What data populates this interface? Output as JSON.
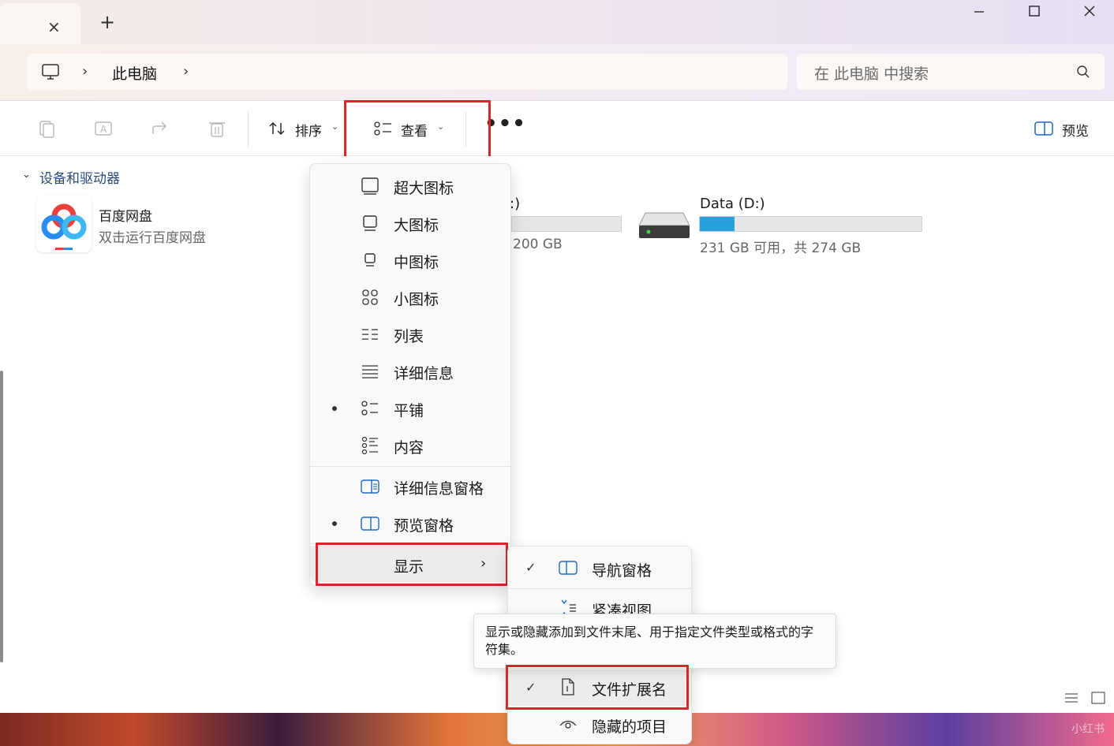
{
  "titlebar": {
    "tab_close": "×",
    "new_tab": "+",
    "minimize": "—",
    "maximize": "☐",
    "close": "✕"
  },
  "address": {
    "chevron": "›",
    "location": "此电脑"
  },
  "search": {
    "placeholder": "在 此电脑 中搜索"
  },
  "toolbar": {
    "sort_label": "排序",
    "view_label": "查看",
    "more_label": "•••",
    "preview_label": "预览",
    "caret": "⌄"
  },
  "content": {
    "section_header": "设备和驱动器",
    "section_chevron": "⌄",
    "app": {
      "name": "百度网盘",
      "subtitle": "双击运行百度网盘"
    },
    "drives": [
      {
        "label_partial": ":)",
        "capacity_partial": "200 GB"
      },
      {
        "label": "Data (D:)",
        "capacity": "231 GB 可用，共 274 GB",
        "used_fraction": 0.157
      }
    ]
  },
  "view_menu": {
    "items": [
      {
        "label": "超大图标",
        "icon": "extra-large-icons-icon",
        "selected": false
      },
      {
        "label": "大图标",
        "icon": "large-icons-icon",
        "selected": false
      },
      {
        "label": "中图标",
        "icon": "medium-icons-icon",
        "selected": false
      },
      {
        "label": "小图标",
        "icon": "small-icons-icon",
        "selected": false
      },
      {
        "label": "列表",
        "icon": "list-icon",
        "selected": false
      },
      {
        "label": "详细信息",
        "icon": "details-icon",
        "selected": false
      },
      {
        "label": "平铺",
        "icon": "tiles-icon",
        "selected": true
      },
      {
        "label": "内容",
        "icon": "content-icon",
        "selected": false
      },
      {
        "label": "详细信息窗格",
        "icon": "details-pane-icon",
        "selected": false
      },
      {
        "label": "预览窗格",
        "icon": "preview-pane-icon",
        "selected": true
      },
      {
        "label": "显示",
        "icon": "",
        "submenu": true
      }
    ],
    "submenu_arrow": "›"
  },
  "show_submenu": {
    "items": [
      {
        "label": "导航窗格",
        "checked": true
      },
      {
        "label": "紧凑视图",
        "checked": false
      },
      {
        "label": "文件扩展名",
        "checked": true
      },
      {
        "label": "隐藏的项目",
        "checked": false
      }
    ],
    "check": "✓"
  },
  "tooltip": {
    "text": "显示或隐藏添加到文件末尾、用于指定文件类型或格式的字符集。"
  },
  "watermark": "小红书",
  "colors": {
    "accent": "#26a0da",
    "highlight_box": "#d8262a",
    "section_header": "#2b4a7a"
  }
}
